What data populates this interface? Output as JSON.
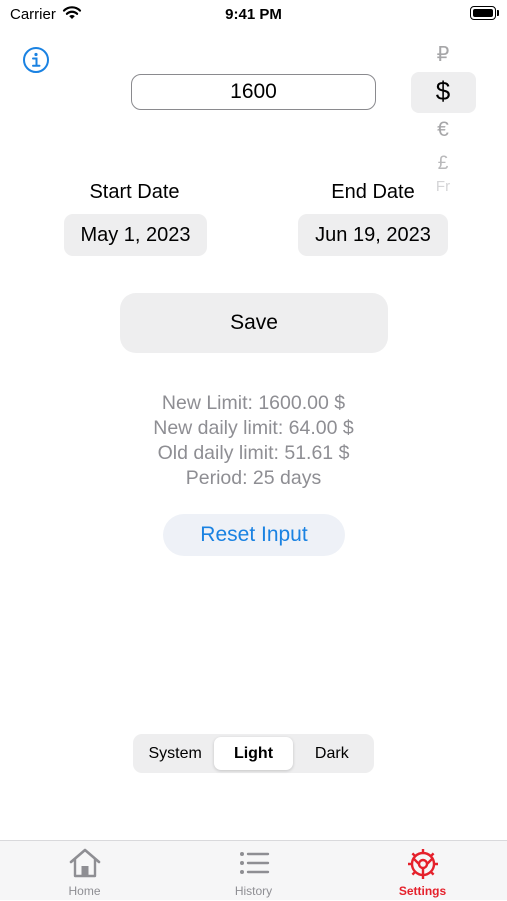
{
  "status_bar": {
    "carrier": "Carrier",
    "time": "9:41 PM"
  },
  "amount": {
    "value": "1600"
  },
  "currency_picker": {
    "options": [
      "₽",
      "$",
      "€",
      "£",
      "Fr"
    ],
    "selected": "$"
  },
  "dates": {
    "start_label": "Start Date",
    "start_value": "May 1, 2023",
    "end_label": "End Date",
    "end_value": "Jun 19, 2023"
  },
  "save_label": "Save",
  "info": {
    "new_limit": "New Limit: 1600.00 $",
    "new_daily_limit": "New daily limit: 64.00 $",
    "old_daily_limit": "Old daily limit: 51.61 $",
    "period": "Period: 25 days"
  },
  "reset_label": "Reset Input",
  "appearance": {
    "options": [
      "System",
      "Light",
      "Dark"
    ],
    "selected": "Light"
  },
  "tabs": [
    {
      "label": "Home",
      "icon": "house-icon",
      "active": false
    },
    {
      "label": "History",
      "icon": "list-icon",
      "active": false
    },
    {
      "label": "Settings",
      "icon": "gear-icon",
      "active": true
    }
  ],
  "colors": {
    "accent_blue": "#1a82e2",
    "active_tab_red": "#e5202b",
    "secondary_text": "#8e8e93",
    "button_fill": "#eeeeef"
  }
}
